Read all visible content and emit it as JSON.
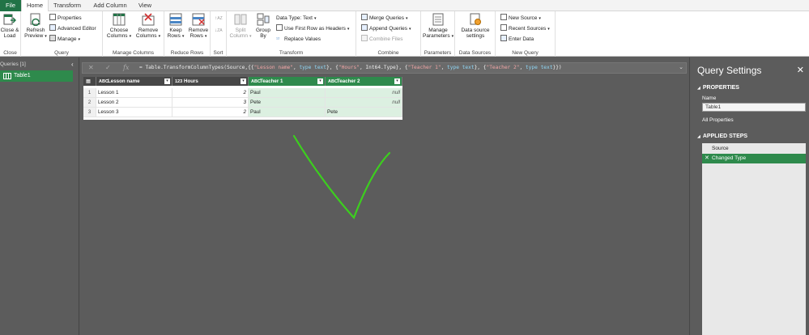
{
  "tabs": [
    "File",
    "Home",
    "Transform",
    "Add Column",
    "View"
  ],
  "ribbon": {
    "close_group": {
      "label": "Close",
      "button": "Close & Load"
    },
    "query_group": {
      "label": "Query",
      "refresh": "Refresh Preview",
      "properties": "Properties",
      "advanced_editor": "Advanced Editor",
      "manage": "Manage"
    },
    "manage_columns_group": {
      "label": "Manage Columns",
      "choose": "Choose Columns",
      "remove": "Remove Columns"
    },
    "reduce_rows_group": {
      "label": "Reduce Rows",
      "keep": "Keep Rows",
      "remove": "Remove Rows"
    },
    "sort_group": {
      "label": "Sort"
    },
    "transform_group": {
      "label": "Transform",
      "split": "Split Column",
      "group_by": "Group By",
      "data_type": "Data Type: Text",
      "first_row": "Use First Row as Headers",
      "replace": "Replace Values"
    },
    "combine_group": {
      "label": "Combine",
      "merge": "Merge Queries",
      "append": "Append Queries",
      "combine_files": "Combine Files"
    },
    "parameters_group": {
      "label": "Parameters",
      "manage": "Manage Parameters"
    },
    "data_sources_group": {
      "label": "Data Sources",
      "settings": "Data source settings"
    },
    "new_query_group": {
      "label": "New Query",
      "new_source": "New Source",
      "recent": "Recent Sources",
      "enter": "Enter Data"
    }
  },
  "queries": {
    "header": "Queries [1]",
    "items": [
      "Table1"
    ]
  },
  "formula": {
    "prefix": "= Table.TransformColumnTypes(Source,{{",
    "parts": [
      {
        "s": "\"Lesson name\""
      },
      {
        "t": ", "
      },
      {
        "k": "type"
      },
      {
        "t": " "
      },
      {
        "k": "text"
      },
      {
        "t": "}, {"
      },
      {
        "s": "\"Hours\""
      },
      {
        "t": ", Int64.Type}, {"
      },
      {
        "s": "\"Teacher 1\""
      },
      {
        "t": ", "
      },
      {
        "k": "type"
      },
      {
        "t": " "
      },
      {
        "k": "text"
      },
      {
        "t": "}, {"
      },
      {
        "s": "\"Teacher 2\""
      },
      {
        "t": ", "
      },
      {
        "k": "type"
      },
      {
        "t": " "
      },
      {
        "k": "text"
      },
      {
        "t": "}})"
      }
    ]
  },
  "table": {
    "columns": [
      {
        "name": "Lesson name",
        "type": "ABC",
        "color": "#474747"
      },
      {
        "name": "Hours",
        "type": "123",
        "color": "#474747"
      },
      {
        "name": "Teacher 1",
        "type": "ABC",
        "color": "#2e8a4c"
      },
      {
        "name": "Teacher 2",
        "type": "ABC",
        "color": "#2e8a4c"
      }
    ],
    "rows": [
      [
        "1",
        "Lesson 1",
        "2",
        "Paul",
        "null"
      ],
      [
        "2",
        "Lesson 2",
        "3",
        "Pete",
        "null"
      ],
      [
        "3",
        "Lesson 3",
        "2",
        "Paul",
        "Pete"
      ]
    ]
  },
  "settings": {
    "title": "Query Settings",
    "properties": "PROPERTIES",
    "name_label": "Name",
    "name_value": "Table1",
    "all_properties": "All Properties",
    "applied_steps": "APPLIED STEPS",
    "steps": [
      "Source",
      "Changed Type"
    ]
  },
  "colors": {
    "accent": "#217346",
    "selected": "#2e8a4c",
    "checkmark": "#3ccf1e"
  }
}
